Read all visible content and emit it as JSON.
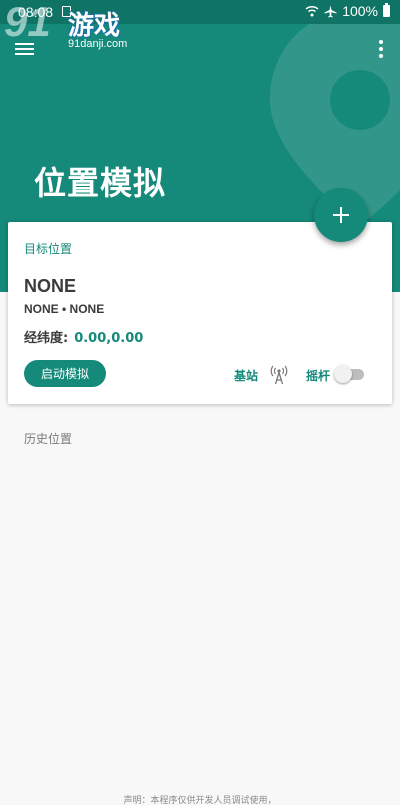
{
  "status_bar": {
    "time": "08:08",
    "battery": "100%",
    "icons": [
      "notification-icon",
      "wifi-icon",
      "airplane-icon",
      "battery-icon"
    ]
  },
  "watermark": {
    "number": "91",
    "text": "游戏",
    "url": "91danji.com"
  },
  "header": {
    "title": "位置模拟",
    "color": "#15897a"
  },
  "card": {
    "label": "目标位置",
    "location_name": "NONE",
    "location_sub": "NONE • NONE",
    "coord_label": "经纬度:",
    "coord_value": "0.00,0.00",
    "start_button": "启动模拟",
    "base_station_label": "基站",
    "joystick_label": "摇杆",
    "joystick_on": false
  },
  "history": {
    "label": "历史位置"
  },
  "footer": {
    "note": "声明：本程序仅供开发人员调试使用，"
  }
}
